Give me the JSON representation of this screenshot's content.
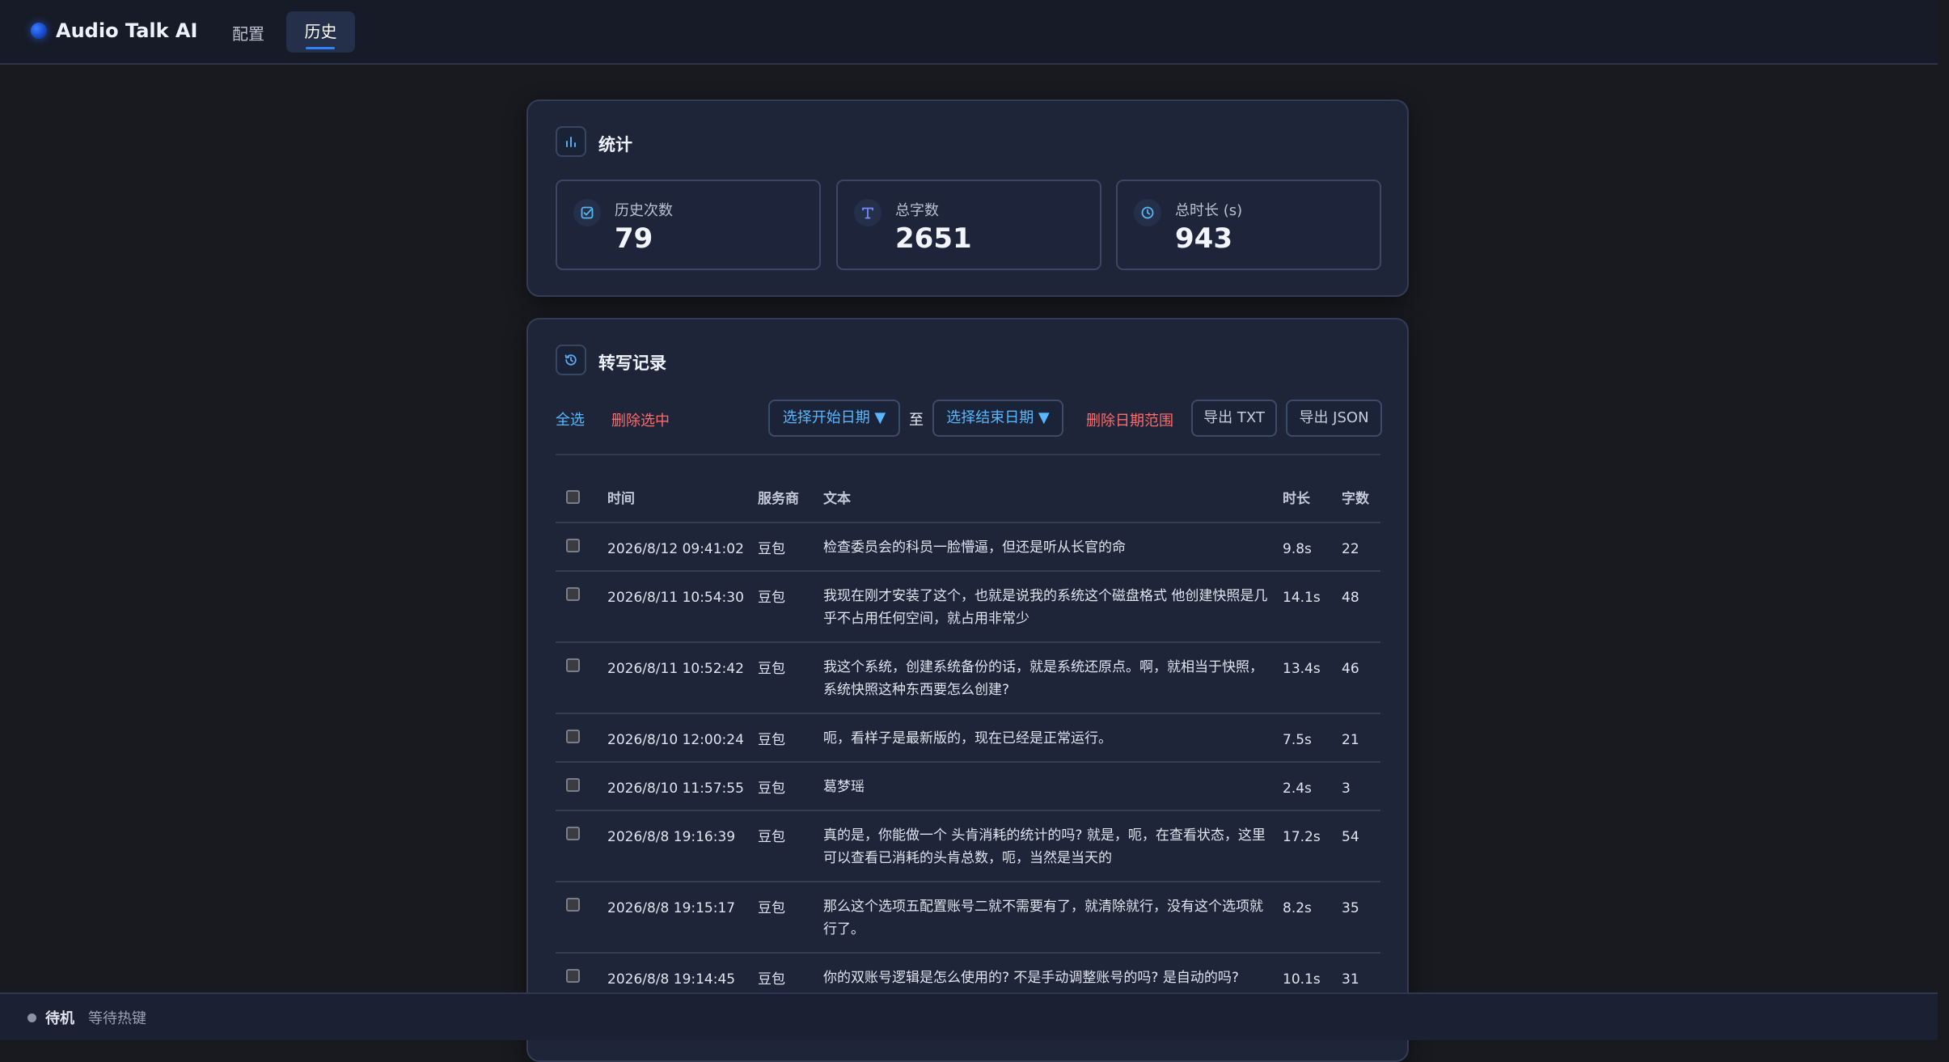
{
  "app": {
    "title": "Audio Talk AI"
  },
  "nav": {
    "config_label": "配置",
    "history_label": "历史"
  },
  "stats": {
    "title": "统计",
    "history_count_label": "历史次数",
    "history_count_value": "79",
    "total_chars_label": "总字数",
    "total_chars_value": "2651",
    "total_duration_label": "总时长 (s)",
    "total_duration_value": "943"
  },
  "records": {
    "title": "转写记录",
    "toolbar": {
      "select_all": "全选",
      "delete_selected": "删除选中",
      "start_date": "选择开始日期 ▼",
      "to": "至",
      "end_date": "选择结束日期 ▼",
      "delete_range": "删除日期范围",
      "export_txt": "导出 TXT",
      "export_json": "导出 JSON"
    },
    "columns": {
      "time": "时间",
      "provider": "服务商",
      "text": "文本",
      "duration": "时长",
      "chars": "字数"
    },
    "rows": [
      {
        "time": "2026/8/12 09:41:02",
        "provider": "豆包",
        "text": "检查委员会的科员一脸懵逼，但还是听从长官的命",
        "duration": "9.8s",
        "chars": "22"
      },
      {
        "time": "2026/8/11 10:54:30",
        "provider": "豆包",
        "text": "我现在刚才安装了这个，也就是说我的系统这个磁盘格式 他创建快照是几乎不占用任何空间，就占用非常少",
        "duration": "14.1s",
        "chars": "48"
      },
      {
        "time": "2026/8/11 10:52:42",
        "provider": "豆包",
        "text": "我这个系统，创建系统备份的话，就是系统还原点。啊，就相当于快照，系统快照这种东西要怎么创建?",
        "duration": "13.4s",
        "chars": "46"
      },
      {
        "time": "2026/8/10 12:00:24",
        "provider": "豆包",
        "text": "呃，看样子是最新版的，现在已经是正常运行。",
        "duration": "7.5s",
        "chars": "21"
      },
      {
        "time": "2026/8/10 11:57:55",
        "provider": "豆包",
        "text": "葛梦瑶",
        "duration": "2.4s",
        "chars": "3"
      },
      {
        "time": "2026/8/8 19:16:39",
        "provider": "豆包",
        "text": "真的是，你能做一个 头肯消耗的统计的吗? 就是，呃，在查看状态，这里可以查看已消耗的头肯总数，呃，当然是当天的",
        "duration": "17.2s",
        "chars": "54"
      },
      {
        "time": "2026/8/8 19:15:17",
        "provider": "豆包",
        "text": "那么这个选项五配置账号二就不需要有了，就清除就行，没有这个选项就行了。",
        "duration": "8.2s",
        "chars": "35"
      },
      {
        "time": "2026/8/8 19:14:45",
        "provider": "豆包",
        "text": "你的双账号逻辑是怎么使用的? 不是手动调整账号的吗? 是自动的吗?",
        "duration": "10.1s",
        "chars": "31"
      }
    ]
  },
  "status": {
    "state": "待机",
    "message": "等待热键"
  },
  "colors": {
    "accent": "#2f82ff",
    "link": "#58b8ff",
    "danger": "#ff6b6b",
    "background": "#181a1f",
    "card": "#1f2538"
  },
  "icons": {
    "logo": "logo-dot-icon",
    "stats": "bar-chart-icon",
    "history_count": "checkbox-icon",
    "total_chars": "text-icon",
    "total_duration": "clock-icon",
    "records": "history-icon"
  }
}
